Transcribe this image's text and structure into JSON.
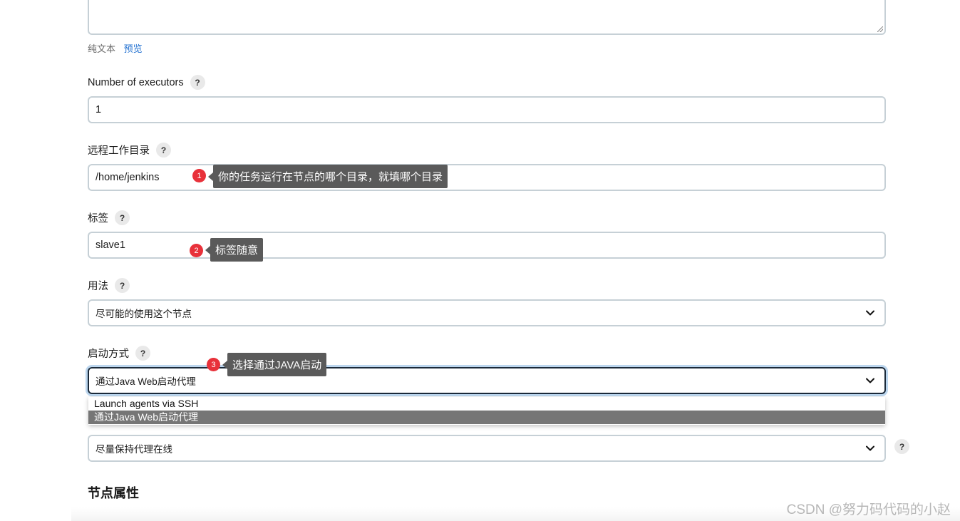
{
  "description_field": {
    "format_plain": "纯文本",
    "format_preview": "预览"
  },
  "executors": {
    "label": "Number of executors",
    "value": "1"
  },
  "remote_dir": {
    "label": "远程工作目录",
    "value": "/home/jenkins"
  },
  "labels": {
    "label": "标签",
    "value": "slave1"
  },
  "usage": {
    "label": "用法",
    "selected": "尽可能的使用这个节点"
  },
  "launch_method": {
    "label": "启动方式",
    "selected": "通过Java Web启动代理",
    "options": [
      "Launch agents via SSH",
      "通过Java Web启动代理"
    ]
  },
  "availability": {
    "selected": "尽量保持代理在线"
  },
  "help_glyph": "?",
  "node_properties": {
    "title": "节点属性"
  },
  "annotations": [
    {
      "number": "1",
      "text": "你的任务运行在节点的哪个目录，就填哪个目录"
    },
    {
      "number": "2",
      "text": "标签随意"
    },
    {
      "number": "3",
      "text": "选择通过JAVA启动"
    }
  ],
  "watermark": "CSDN @努力码代码的小赵",
  "colors": {
    "annotation_badge": "#e8313a",
    "annotation_tip": "#5a5a5a",
    "link": "#1f6fd0",
    "selected_option_bg": "#767676"
  }
}
